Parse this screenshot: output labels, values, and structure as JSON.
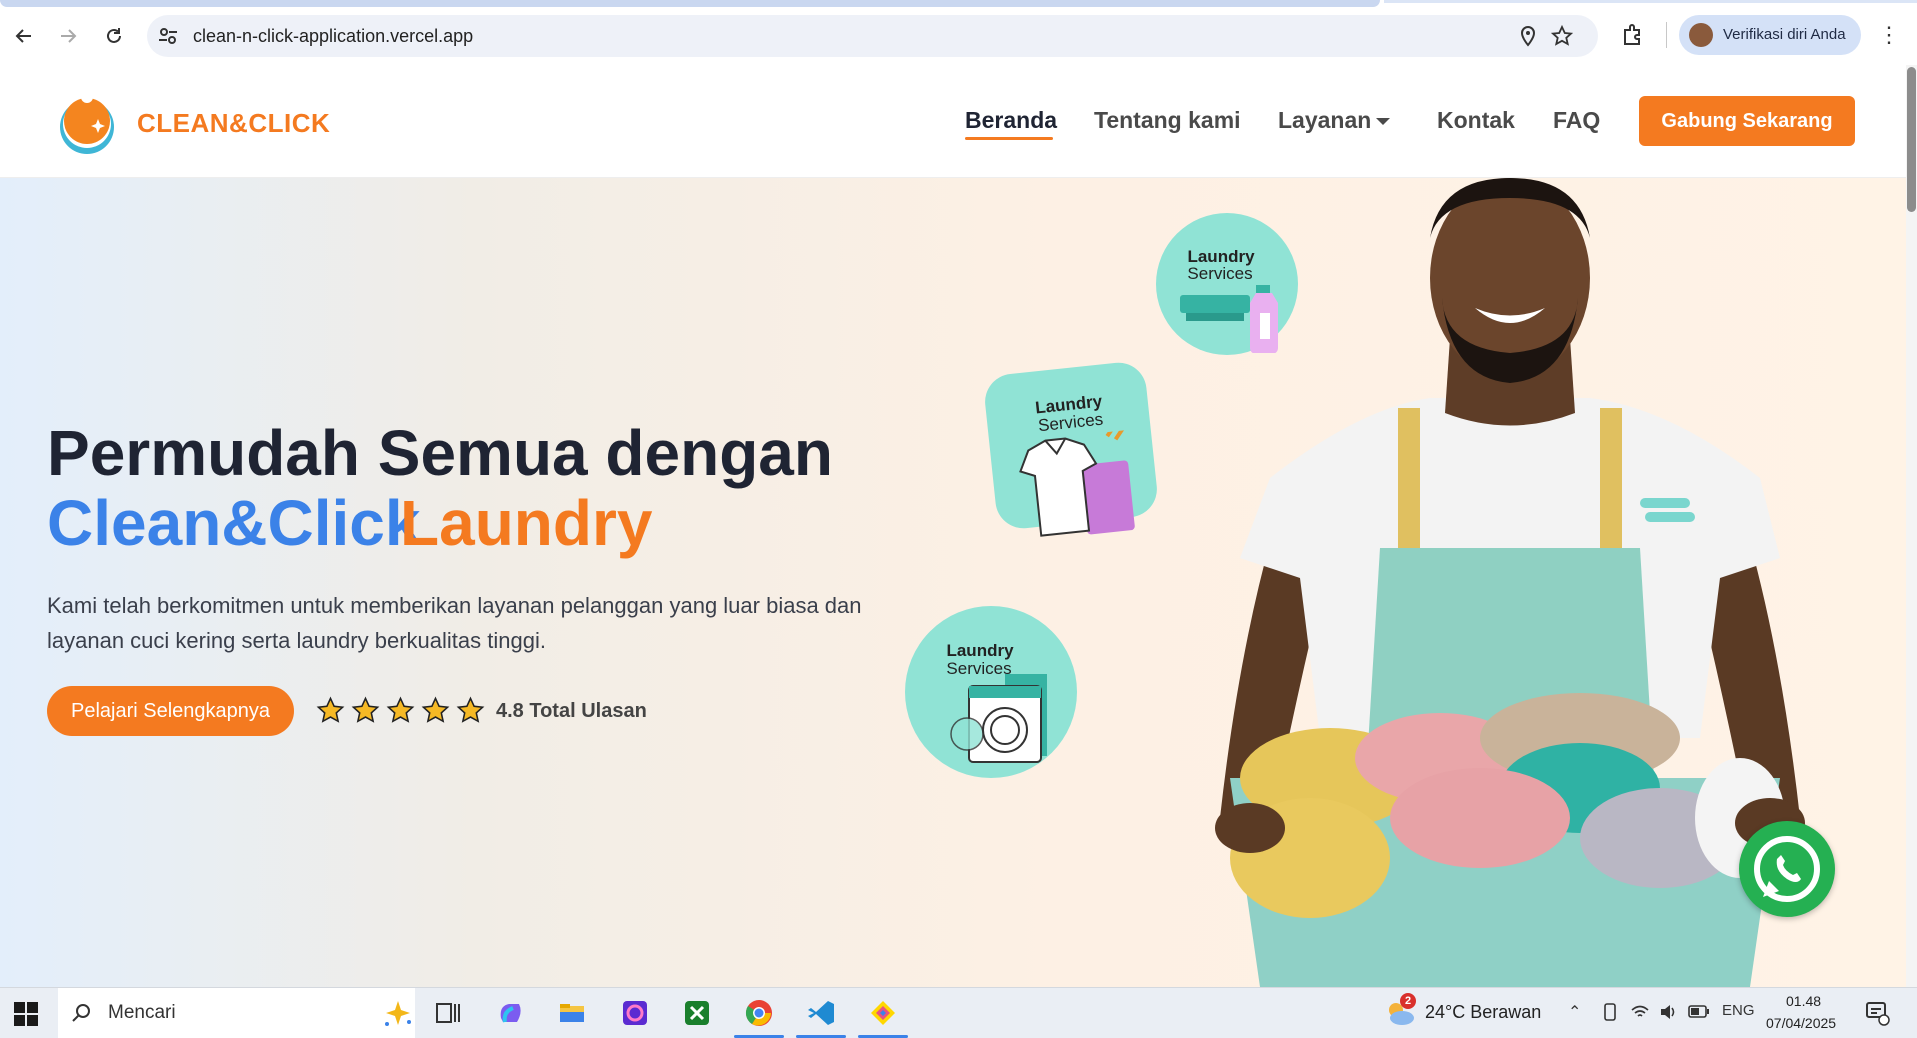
{
  "browser": {
    "url": "clean-n-click-application.vercel.app",
    "profile_label": "Verifikasi diri Anda"
  },
  "site": {
    "brand": "CLEAN&CLICK",
    "nav": {
      "home": "Beranda",
      "about": "Tentang kami",
      "services": "Layanan",
      "contact": "Kontak",
      "faq": "FAQ",
      "cta": "Gabung Sekarang"
    }
  },
  "hero": {
    "title_line1": "Permudah Semua dengan",
    "title_brand": "Clean&Click",
    "title_accent": "Laundry",
    "description": "Kami telah berkomitmen untuk memberikan layanan pelanggan yang luar biasa dan layanan cuci kering serta laundry berkualitas tinggi.",
    "button": "Pelajari Selengkapnya",
    "rating_text": "4.8 Total Ulasan",
    "stars": 5,
    "badges": [
      {
        "title": "Laundry",
        "subtitle": "Services"
      },
      {
        "title": "Laundry",
        "subtitle": "Services"
      },
      {
        "title": "Laundry",
        "subtitle": "Services"
      }
    ]
  },
  "taskbar": {
    "search_placeholder": "Mencari",
    "weather": "24°C  Berawan",
    "weather_badge": "2",
    "lang": "ENG",
    "time": "01.48",
    "date": "07/04/2025"
  },
  "colors": {
    "accent": "#f47a20",
    "brand_blue": "#3b82e8",
    "badge_teal": "#90e3d5",
    "whatsapp": "#25b052"
  }
}
